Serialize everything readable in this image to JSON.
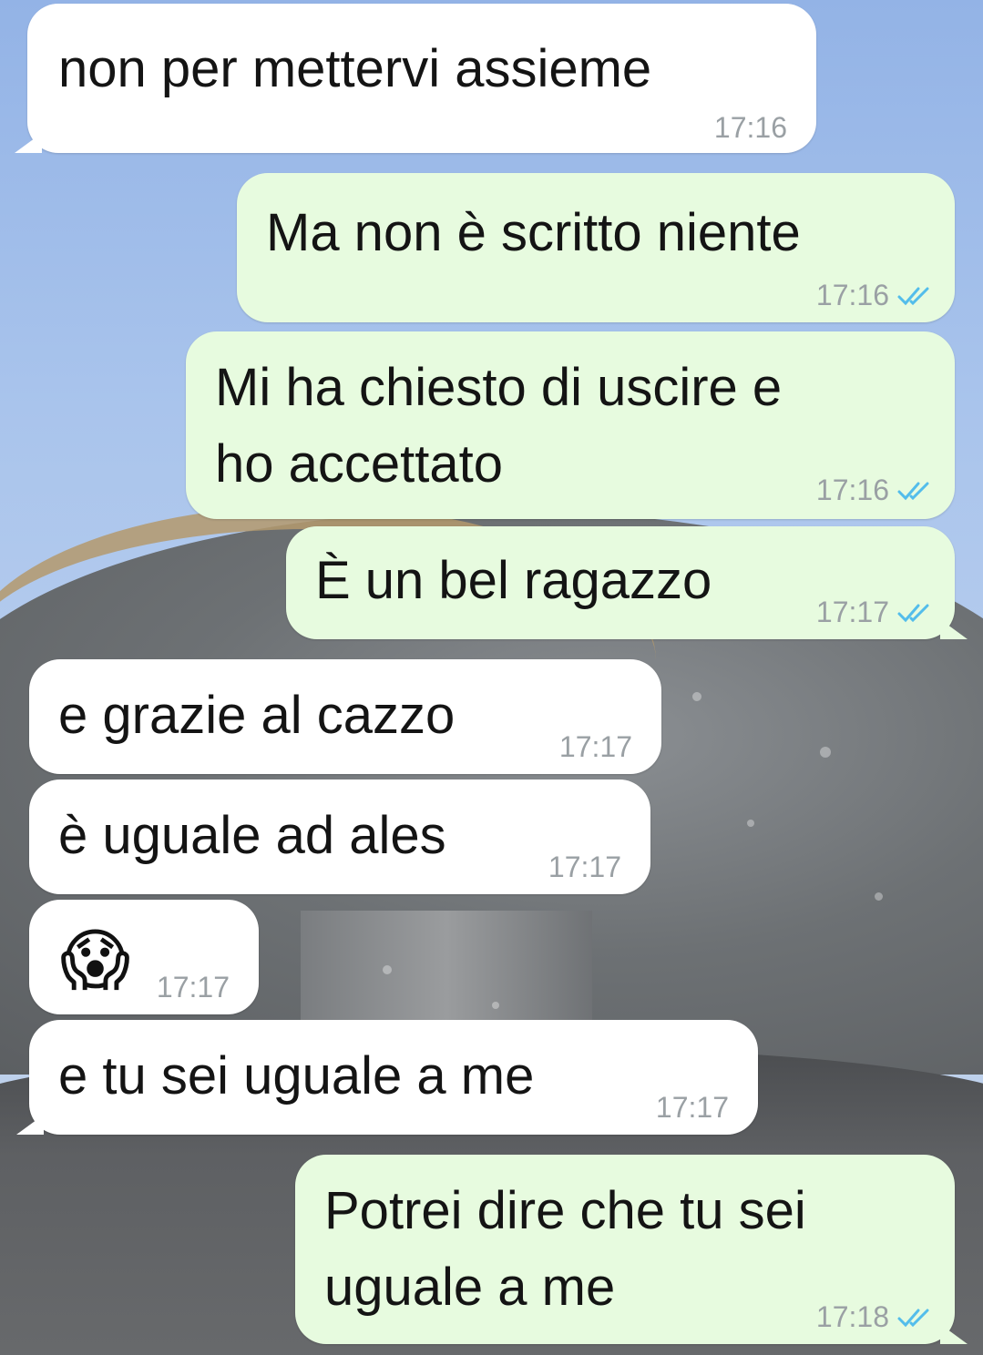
{
  "colors": {
    "incoming_bubble": "#ffffff",
    "outgoing_bubble": "#e7fbdf",
    "timestamp": "#9aa0a4",
    "read_check": "#53bdeb"
  },
  "messages": [
    {
      "direction": "incoming",
      "text": "non per mettervi assieme",
      "time": "17:16"
    },
    {
      "direction": "outgoing",
      "text": "Ma non è scritto niente",
      "time": "17:16",
      "status": "read-double-check-icon"
    },
    {
      "direction": "outgoing",
      "text": "Mi ha chiesto di uscire e\nho accettato",
      "time": "17:16",
      "status": "read-double-check-icon"
    },
    {
      "direction": "outgoing",
      "text": "È un bel ragazzo",
      "time": "17:17",
      "status": "read-double-check-icon"
    },
    {
      "direction": "incoming",
      "text": "e grazie al cazzo",
      "time": "17:17"
    },
    {
      "direction": "incoming",
      "text": "è uguale ad ales",
      "time": "17:17"
    },
    {
      "direction": "incoming",
      "text": "😱",
      "time": "17:17"
    },
    {
      "direction": "incoming",
      "text": "e tu sei uguale a me",
      "time": "17:17"
    },
    {
      "direction": "outgoing",
      "text": "Potrei dire che tu sei\nuguale a me",
      "time": "17:18",
      "status": "read-double-check-icon"
    }
  ]
}
